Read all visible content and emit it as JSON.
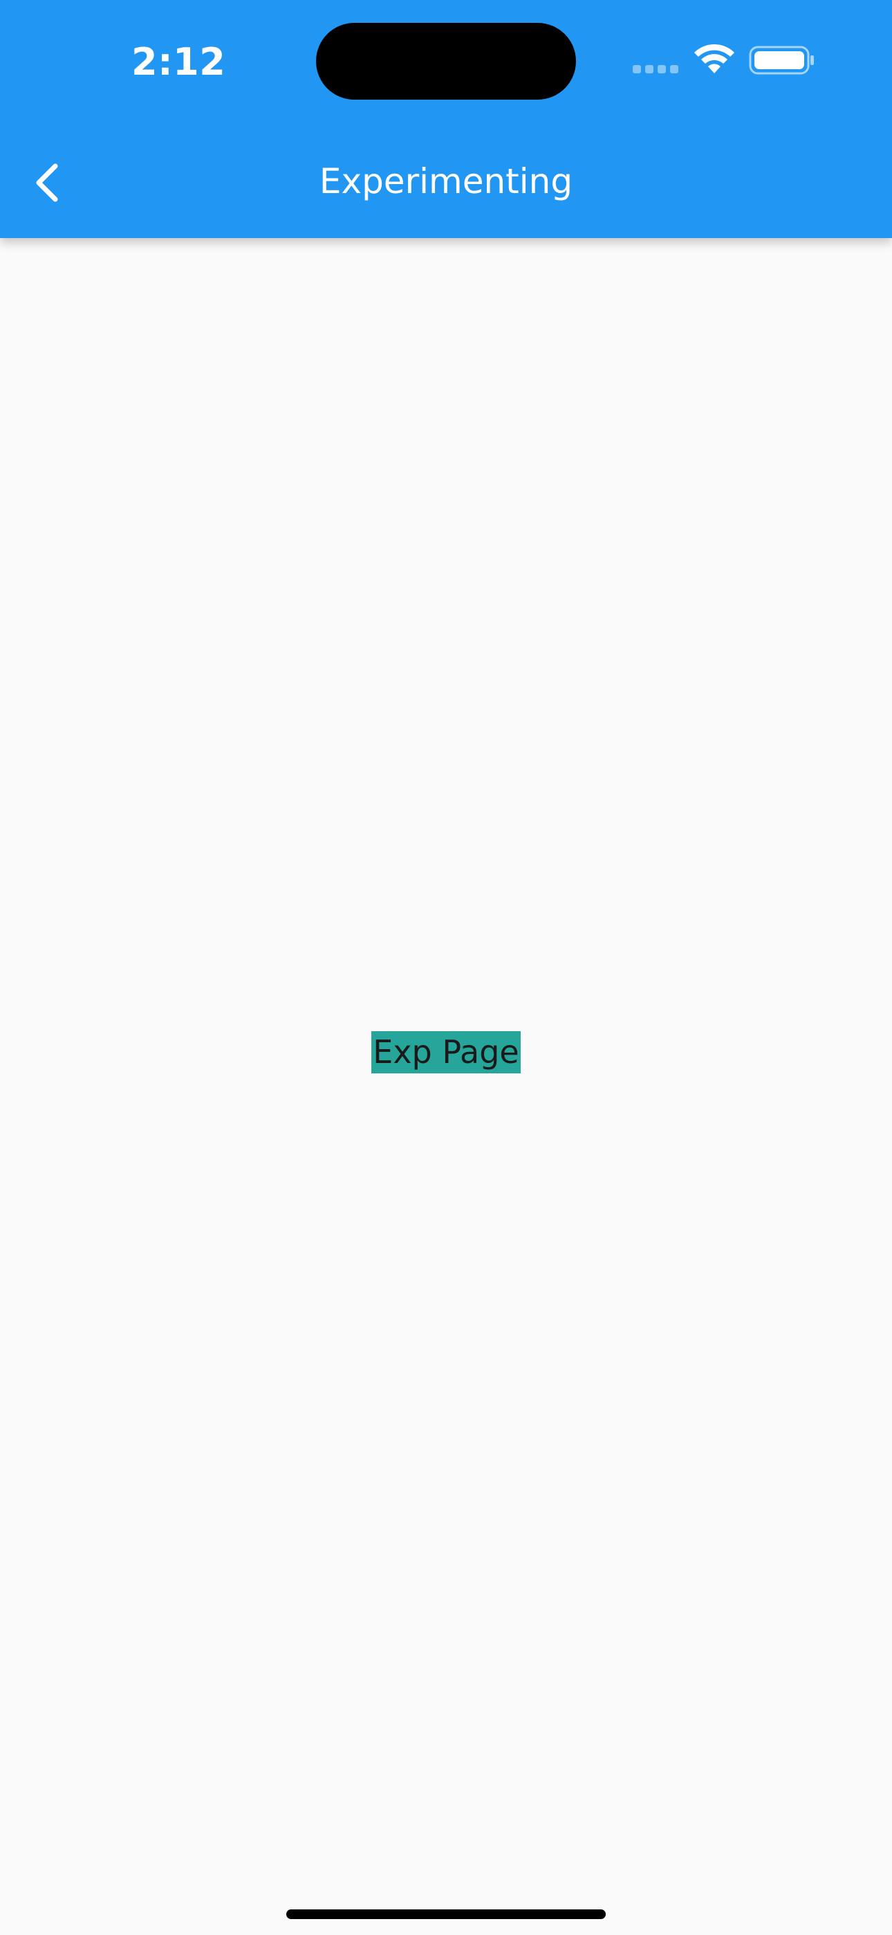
{
  "status_bar": {
    "time": "2:12",
    "signal_icon": "cellular-signal-icon",
    "wifi_icon": "wifi-icon",
    "battery_icon": "battery-icon"
  },
  "app_bar": {
    "title": "Experimenting",
    "back_icon": "chevron-left-icon",
    "background_color": "#2196f3",
    "text_color": "#ffffff"
  },
  "main": {
    "label": "Exp Page",
    "label_background_color": "#26a69a",
    "background_color": "#fafafa"
  }
}
